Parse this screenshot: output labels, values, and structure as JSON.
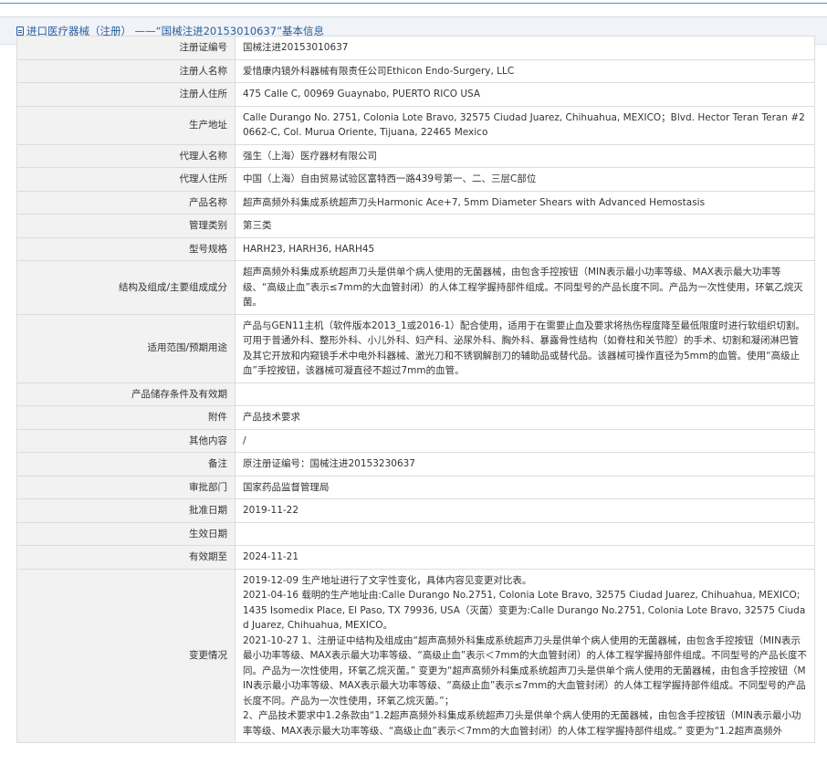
{
  "header": {
    "title": "进口医疗器械（注册） ——“国械注进20153010637”基本信息"
  },
  "rows": [
    {
      "label": "注册证编号",
      "value": "国械注进20153010637"
    },
    {
      "label": "注册人名称",
      "value": "爱惜康内镜外科器械有限责任公司Ethicon Endo-Surgery, LLC"
    },
    {
      "label": "注册人住所",
      "value": "475 Calle C, 00969 Guaynabo, PUERTO RICO USA"
    },
    {
      "label": "生产地址",
      "value": "Calle Durango No. 2751, Colonia Lote Bravo, 32575 Ciudad Juarez, Chihuahua, MEXICO；Blvd. Hector Teran Teran #20662-C, Col. Murua Oriente, Tijuana, 22465 Mexico"
    },
    {
      "label": "代理人名称",
      "value": "强生（上海）医疗器材有限公司"
    },
    {
      "label": "代理人住所",
      "value": "中国（上海）自由贸易试验区富特西一路439号第一、二、三层C部位"
    },
    {
      "label": "产品名称",
      "value": "超声高频外科集成系统超声刀头Harmonic Ace+7, 5mm Diameter Shears with Advanced Hemostasis"
    },
    {
      "label": "管理类别",
      "value": "第三类"
    },
    {
      "label": "型号规格",
      "value": "HARH23, HARH36, HARH45"
    },
    {
      "label": "结构及组成/主要组成成分",
      "value": "超声高频外科集成系统超声刀头是供单个病人使用的无菌器械，由包含手控按钮（MIN表示最小功率等级、MAX表示最大功率等级、“高级止血”表示≤7mm的大血管封闭）的人体工程学握持部件组成。不同型号的产品长度不同。产品为一次性使用，环氧乙烷灭菌。"
    },
    {
      "label": "适用范围/预期用途",
      "value": "产品与GEN11主机（软件版本2013_1或2016-1）配合使用，适用于在需要止血及要求将热伤程度降至最低限度时进行软组织切割。可用于普通外科、整形外科、小儿外科、妇产科、泌尿外科、胸外科、暴露骨性结构（如脊柱和关节腔）的手术、切割和凝闭淋巴管及其它开放和内窥镜手术中电外科器械、激光刀和不锈钢解剖刀的辅助品或替代品。该器械可操作直径为5mm的血管。使用“高级止血”手控按钮，该器械可凝直径不超过7mm的血管。"
    },
    {
      "label": "产品储存条件及有效期",
      "value": ""
    },
    {
      "label": "附件",
      "value": "产品技术要求"
    },
    {
      "label": "其他内容",
      "value": "/"
    },
    {
      "label": "备注",
      "value": "原注册证编号：国械注进20153230637"
    },
    {
      "label": "审批部门",
      "value": "国家药品监督管理局"
    },
    {
      "label": "批准日期",
      "value": "2019-11-22"
    },
    {
      "label": "生效日期",
      "value": ""
    },
    {
      "label": "有效期至",
      "value": "2024-11-21"
    }
  ],
  "changes": {
    "label": "变更情况",
    "lines": [
      "2019-12-09 生产地址进行了文字性变化，具体内容见变更对比表。",
      "2021-04-16 载明的生产地址由:Calle Durango No.2751, Colonia Lote Bravo, 32575 Ciudad Juarez, Chihuahua, MEXICO; 1435 Isomedix Place, El Paso, TX 79936, USA（灭菌）变更为:Calle Durango No.2751, Colonia Lote Bravo, 32575 Ciudad Juarez, Chihuahua, MEXICO。",
      "2021-10-27 1、注册证中结构及组成由“超声高频外科集成系统超声刀头是供单个病人使用的无菌器械，由包含手控按钮（MIN表示最小功率等级、MAX表示最大功率等级、“高级止血”表示＜7mm的大血管封闭）的人体工程学握持部件组成。不同型号的产品长度不同。产品为一次性使用，环氧乙烷灭菌。” 变更为“超声高频外科集成系统超声刀头是供单个病人使用的无菌器械，由包含手控按钮（MIN表示最小功率等级、MAX表示最大功率等级、“高级止血”表示≤7mm的大血管封闭）的人体工程学握持部件组成。不同型号的产品长度不同。产品为一次性使用，环氧乙烷灭菌。”；",
      "2、产品技术要求中1.2条款由“1.2超声高频外科集成系统超声刀头是供单个病人使用的无菌器械，由包含手控按钮（MIN表示最小功率等级、MAX表示最大功率等级、“高级止血”表示＜7mm的大血管封闭）的人体工程学握持部件组成。” 变更为“1.2超声高频外"
    ]
  }
}
